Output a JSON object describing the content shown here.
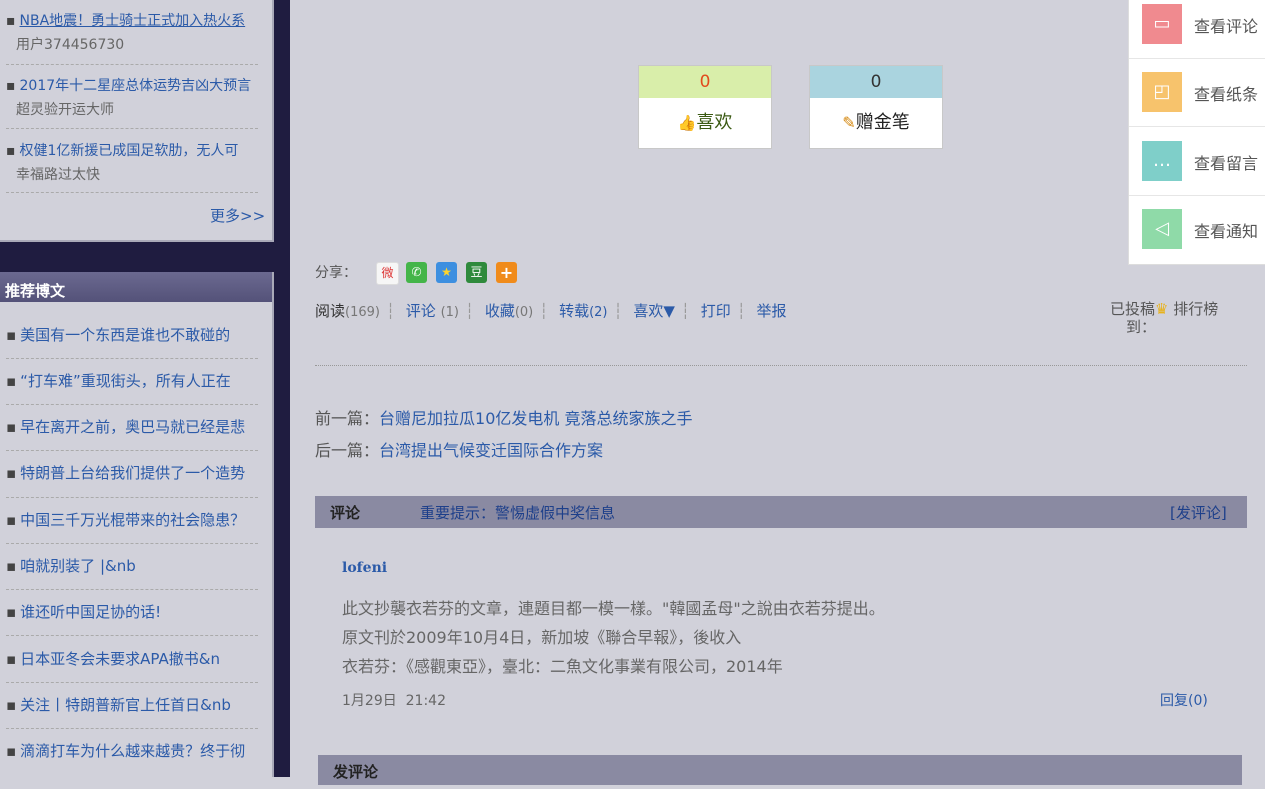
{
  "left_news": [
    {
      "title": "NBA地震！勇士骑士正式加入热火系",
      "user": "用户374456730"
    },
    {
      "title": "2017年十二星座总体运势吉凶大预言",
      "user": "超灵验开运大师"
    },
    {
      "title": "权健1亿新援已成国足软肋，无人可",
      "user": "幸福路过太快"
    }
  ],
  "more_label": "更多>>",
  "recommended": {
    "heading": "推荐博文",
    "items": [
      "美国有一个东西是谁也不敢碰的",
      "“打车难”重现街头，所有人正在",
      "早在离开之前，奥巴马就已经是悲",
      "特朗普上台给我们提供了一个造势",
      "中国三千万光棍带来的社会隐患？",
      "咱就别装了 |&nb",
      "谁还听中国足协的话!",
      "日本亚冬会未要求APA撤书&n",
      "关注丨特朗普新官上任首日&nb",
      "滴滴打车为什么越来越贵？终于彻"
    ]
  },
  "votes": {
    "like": {
      "count": "0",
      "label": "喜欢",
      "count_color": "#e24b1d",
      "bg": "#d9eeaa"
    },
    "pen": {
      "count": "0",
      "label": "赠金笔",
      "count_color": "#333333",
      "bg": "#aad4df"
    }
  },
  "share": {
    "label": "分享：",
    "icons": [
      "weibo-icon",
      "wechat-icon",
      "qzone-icon",
      "douban-icon",
      "more-share-icon"
    ]
  },
  "toolbar": {
    "read": "阅读",
    "read_count": "(169)",
    "comment": "评论",
    "comment_count": "(1)",
    "fav": "收藏",
    "fav_count": "(0)",
    "repost": "转载",
    "repost_count": "(2)",
    "like": "喜欢▼",
    "print": "打印",
    "report": "举报"
  },
  "rank": {
    "prefix": "已投稿",
    "suffix": "排行榜",
    "to": "到："
  },
  "prevnext": {
    "prev_label": "前一篇：",
    "prev_title": "台赠尼加拉瓜10亿发电机 竟落总统家族之手",
    "next_label": "后一篇：",
    "next_title": "台湾提出气候变迁国际合作方案"
  },
  "comment_bar": {
    "title": "评论",
    "notice": "重要提示：警惕虚假中奖信息",
    "action": "[发评论]"
  },
  "comment": {
    "user": "lofeni",
    "lines": [
      "此文抄襲衣若芬的文章，連題目都一模一樣。\"韓國孟母\"之說由衣若芬提出。",
      "原文刊於2009年10月4日，新加坡《聯合早報》，後收入",
      "衣若芬：《感觀東亞》，臺北：二魚文化事業有限公司，2014年"
    ],
    "date": "1月29日",
    "time": "21:42",
    "reply": "回复(0)"
  },
  "footer_bar": {
    "title": "发评论"
  },
  "float_menu": [
    {
      "label": "查看评论",
      "icon": "comment-icon",
      "color": "#f08a8f"
    },
    {
      "label": "查看纸条",
      "icon": "note-icon",
      "color": "#f7c36c"
    },
    {
      "label": "查看留言",
      "icon": "message-icon",
      "color": "#7fcfc9"
    },
    {
      "label": "查看通知",
      "icon": "notification-icon",
      "color": "#8fdaa8"
    }
  ]
}
